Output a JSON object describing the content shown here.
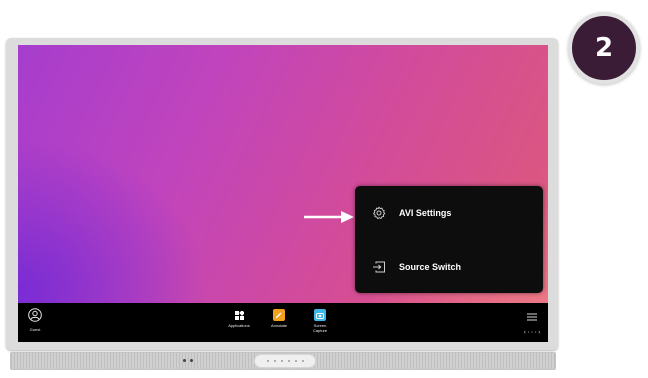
{
  "step_badge": "2",
  "menu": {
    "items": [
      {
        "label": "AVI Settings",
        "icon": "gear-icon"
      },
      {
        "label": "Source Switch",
        "icon": "input-source-icon"
      }
    ]
  },
  "taskbar": {
    "user_label": "Guest",
    "apps": [
      {
        "label": "Applications",
        "icon": "applications-grid-icon"
      },
      {
        "label": "Annotate",
        "icon": "annotate-icon"
      },
      {
        "label": "Screen Capture",
        "icon": "screen-capture-icon"
      }
    ],
    "code_glyph": "‹···›"
  },
  "colors": {
    "badge": "#3b1c36",
    "menu_bg": "#0d0d0d",
    "annotate": "#f3a01e",
    "screen_capture": "#3fb6e8",
    "wallpaper_start": "#a63dcd",
    "wallpaper_end": "#de5a78"
  }
}
